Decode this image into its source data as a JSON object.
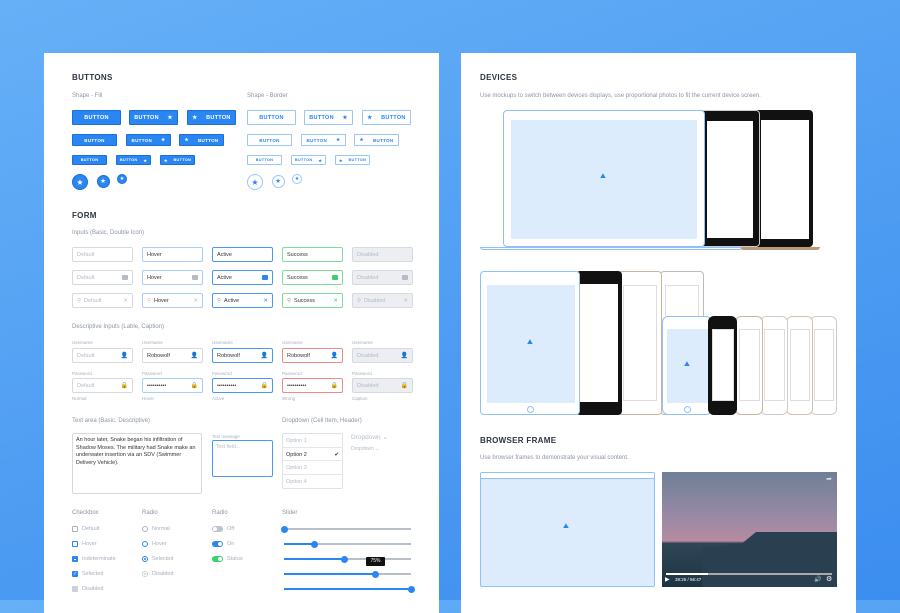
{
  "colors": {
    "accent": "#2a86f3",
    "success": "#3ccf6b",
    "error": "#ef4b4b",
    "disabled": "#eceef1"
  },
  "buttons": {
    "title": "BUTTONS",
    "fill_label": "Shape - Fill",
    "border_label": "Shape - Border",
    "button_label": "BUTTON",
    "icon": "star-icon"
  },
  "form": {
    "title": "FORM",
    "inputs_label": "Inputs (Basic, Double Icon)",
    "input_states": [
      "Default",
      "Hover",
      "Active",
      "Success",
      "Disabled"
    ],
    "descriptive_label": "Descriptive Inputs (Lable, Caption)",
    "username_label": "Username",
    "password_label": "Password",
    "username_values": [
      "Default",
      "Robowolf",
      "Robowolf",
      "Robowolf",
      "Disabled"
    ],
    "password_values": [
      "Default",
      "••••••••••",
      "••••••••••",
      "••••••••••",
      "Disabled"
    ],
    "captions": [
      "Normal",
      "Hover",
      "Active",
      "Wrong",
      "Caption"
    ],
    "textarea_label": "Text area (Basic, Descriptive)",
    "textarea_value": "An hour later, Snake began his infiltration of Shadow Moses. The military had Snake make an underwater insertion via an SDV (Swimmer Delivery Vehicle).",
    "text_message_label": "Text message",
    "text_field_placeholder": "Text field...",
    "dropdown_label": "Dropdown (Cell Item, Header)",
    "dropdown_options": [
      "Option 1",
      "Option 2",
      "Option 3",
      "Option 4"
    ],
    "dropdown_selected": "Option 2",
    "dropdown_header": "Dropdown",
    "dropdown_header_small": "Dropdown",
    "checkbox_label": "Checkbox",
    "checkboxes": [
      "Default",
      "Hover",
      "Indeterminate",
      "Selected",
      "Disabled"
    ],
    "radio_label": "Radio",
    "radios": [
      "Normal",
      "Hover",
      "Selected",
      "Disabled"
    ],
    "toggle_label": "Radio",
    "toggles": [
      "Off",
      "On",
      "Status"
    ],
    "slider_label": "Slider",
    "slider_values": [
      0,
      24,
      48,
      72,
      100
    ],
    "slider_tooltip": "75%"
  },
  "devices": {
    "title": "DEVICES",
    "description": "Use mockups to switch between devices displays, use proportional photos to fit the current device screen."
  },
  "browser": {
    "title": "BROWSER FRAME",
    "description": "Use browser frames to demonstrate your visual content.",
    "video_time": "38:25 / 56:47",
    "video_progress": 0.25
  }
}
